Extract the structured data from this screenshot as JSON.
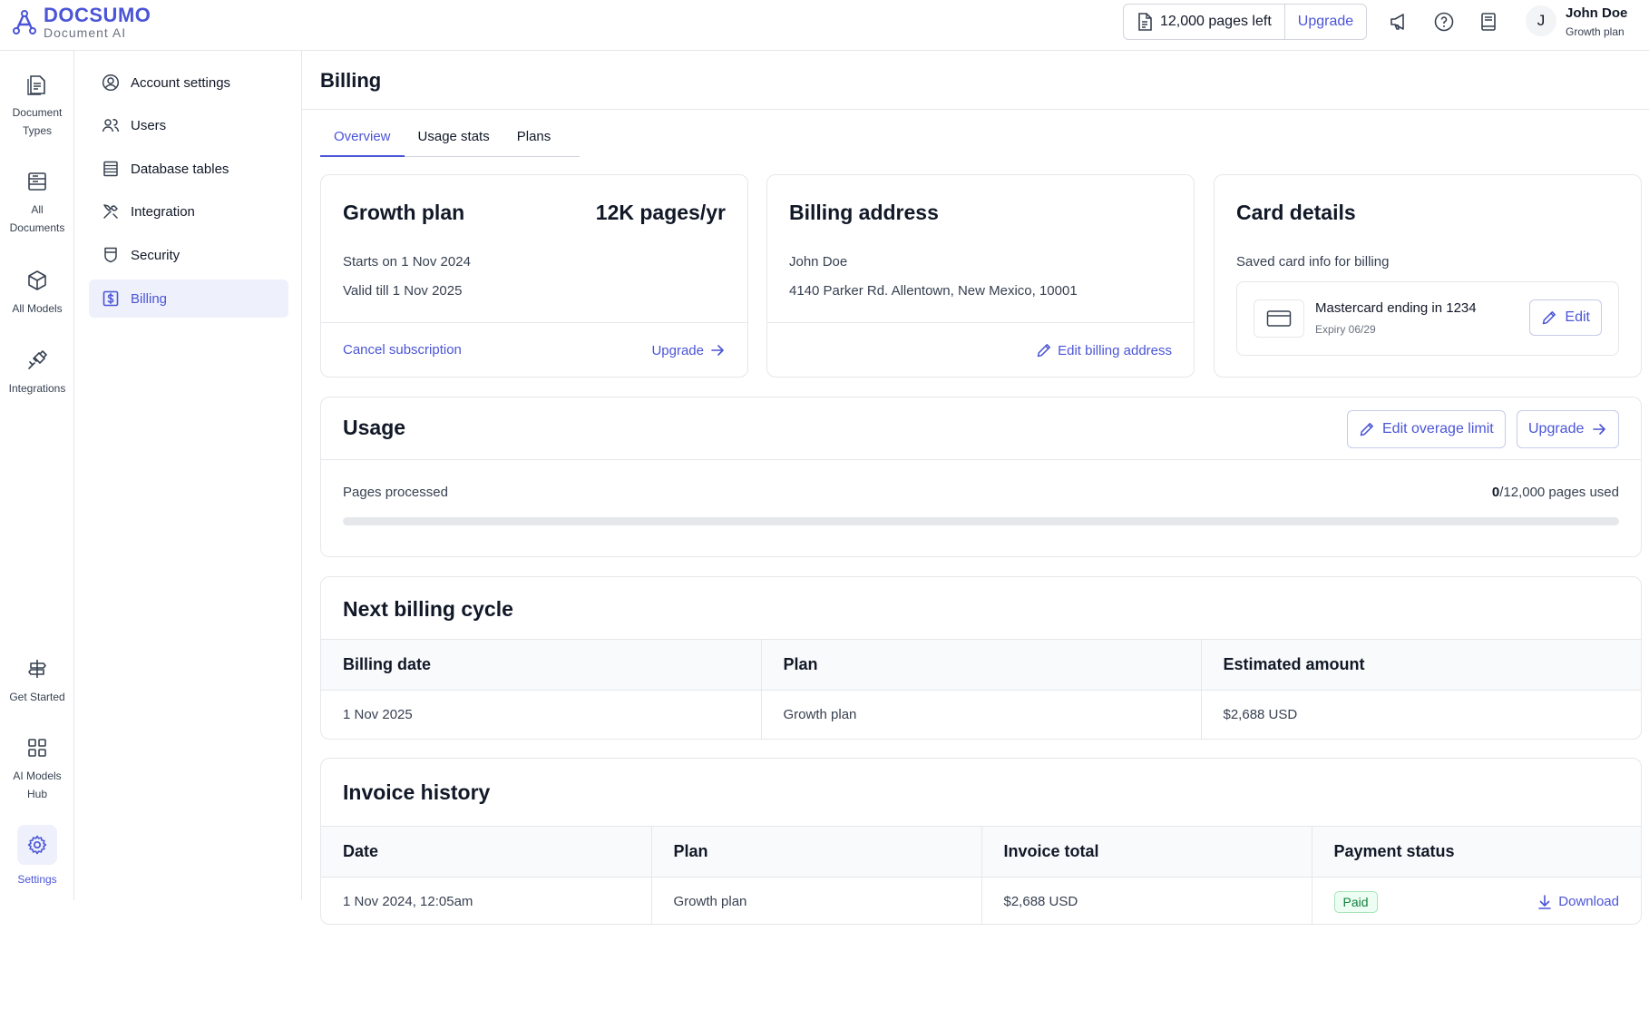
{
  "app": {
    "brand": "DOCSUMO",
    "brand_sub": "Document AI"
  },
  "topbar": {
    "pages_left": "12,000 pages left",
    "upgrade": "Upgrade",
    "user_initial": "J",
    "user_name": "John Doe",
    "user_plan": "Growth plan",
    "icons": [
      "document-icon",
      "megaphone-icon",
      "help-icon",
      "book-icon"
    ]
  },
  "rail": {
    "items": [
      {
        "label": "Document Types",
        "icon": "document-types-icon"
      },
      {
        "label": "All Documents",
        "icon": "all-documents-icon"
      },
      {
        "label": "All Models",
        "icon": "cube-icon"
      },
      {
        "label": "Integrations",
        "icon": "plug-icon"
      },
      {
        "label": "Get Started",
        "icon": "signpost-icon"
      },
      {
        "label": "AI Models Hub",
        "icon": "grid-icon"
      },
      {
        "label": "Settings",
        "icon": "gear-icon",
        "active": true
      }
    ]
  },
  "subnav": {
    "items": [
      {
        "label": "Account settings",
        "icon": "user-circle-icon"
      },
      {
        "label": "Users",
        "icon": "users-icon"
      },
      {
        "label": "Database tables",
        "icon": "table-icon"
      },
      {
        "label": "Integration",
        "icon": "tools-icon"
      },
      {
        "label": "Security",
        "icon": "shield-icon"
      },
      {
        "label": "Billing",
        "icon": "dollar-icon",
        "active": true
      }
    ]
  },
  "page": {
    "title": "Billing",
    "tabs": [
      {
        "label": "Overview",
        "active": true
      },
      {
        "label": "Usage stats"
      },
      {
        "label": "Plans"
      }
    ]
  },
  "plan_card": {
    "title": "Growth plan",
    "quota": "12K pages/yr",
    "starts": "Starts on 1 Nov 2024",
    "valid": "Valid till 1 Nov 2025",
    "cancel": "Cancel subscription",
    "upgrade": "Upgrade"
  },
  "address_card": {
    "title": "Billing address",
    "name": "John Doe",
    "address": "4140 Parker Rd. Allentown, New Mexico, 10001",
    "edit": "Edit billing address"
  },
  "card_details": {
    "title": "Card details",
    "subtitle": "Saved card info for billing",
    "card_name": "Mastercard ending in 1234",
    "expiry": "Expiry 06/29",
    "edit": "Edit"
  },
  "usage": {
    "title": "Usage",
    "edit_overage": "Edit overage limit",
    "upgrade": "Upgrade",
    "label": "Pages processed",
    "used": "0",
    "total": "/12,000 pages used",
    "fraction": 0
  },
  "next_billing": {
    "title": "Next billing cycle",
    "columns": [
      "Billing date",
      "Plan",
      "Estimated amount"
    ],
    "rows": [
      [
        "1 Nov 2025",
        "Growth plan",
        "$2,688 USD"
      ]
    ]
  },
  "invoices": {
    "title": "Invoice history",
    "columns": [
      "Date",
      "Plan",
      "Invoice total",
      "Payment status"
    ],
    "rows": [
      {
        "date": "1 Nov 2024, 12:05am",
        "plan": "Growth plan",
        "total": "$2,688 USD",
        "status": "Paid",
        "action": "Download"
      }
    ]
  },
  "colors": {
    "accent": "#4b55d6",
    "accent_bg": "#eef0fb",
    "paid": "#15803d"
  }
}
